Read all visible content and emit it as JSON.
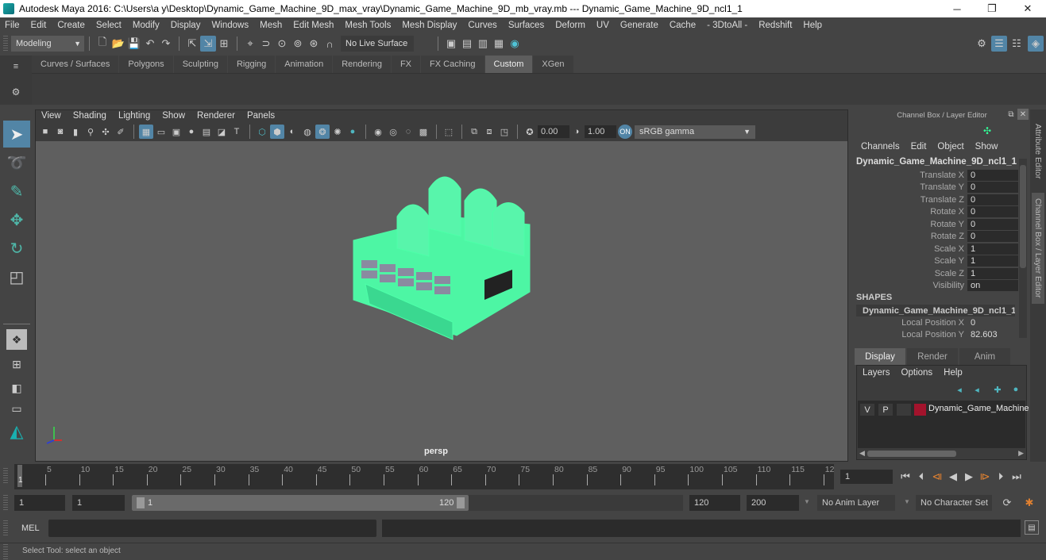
{
  "window": {
    "title": "Autodesk Maya 2016: C:\\Users\\a y\\Desktop\\Dynamic_Game_Machine_9D_max_vray\\Dynamic_Game_Machine_9D_mb_vray.mb  ---  Dynamic_Game_Machine_9D_ncl1_1",
    "minimize": "─",
    "maximize": "❐",
    "close": "✕"
  },
  "menubar": [
    "File",
    "Edit",
    "Create",
    "Select",
    "Modify",
    "Display",
    "Windows",
    "Mesh",
    "Edit Mesh",
    "Mesh Tools",
    "Mesh Display",
    "Curves",
    "Surfaces",
    "Deform",
    "UV",
    "Generate",
    "Cache",
    "- 3DtoAll -",
    "Redshift",
    "Help"
  ],
  "statusline": {
    "mode": "Modeling",
    "live_surface": "No Live Surface"
  },
  "shelf": {
    "tabs": [
      "Curves / Surfaces",
      "Polygons",
      "Sculpting",
      "Rigging",
      "Animation",
      "Rendering",
      "FX",
      "FX Caching",
      "Custom",
      "XGen"
    ],
    "active_tab": "Custom"
  },
  "panel": {
    "menu": [
      "View",
      "Shading",
      "Lighting",
      "Show",
      "Renderer",
      "Panels"
    ],
    "exposure": "0.00",
    "gamma": "1.00",
    "color_space": "sRGB gamma",
    "camera_label": "persp"
  },
  "channelbox": {
    "header": "Channel Box / Layer Editor",
    "menu": [
      "Channels",
      "Edit",
      "Object",
      "Show"
    ],
    "object_name": "Dynamic_Game_Machine_9D_ncl1_1",
    "channels": [
      {
        "name": "Translate X",
        "value": "0"
      },
      {
        "name": "Translate Y",
        "value": "0"
      },
      {
        "name": "Translate Z",
        "value": "0"
      },
      {
        "name": "Rotate X",
        "value": "0"
      },
      {
        "name": "Rotate Y",
        "value": "0"
      },
      {
        "name": "Rotate Z",
        "value": "0"
      },
      {
        "name": "Scale X",
        "value": "1"
      },
      {
        "name": "Scale Y",
        "value": "1"
      },
      {
        "name": "Scale Z",
        "value": "1"
      },
      {
        "name": "Visibility",
        "value": "on"
      }
    ],
    "shapes_label": "SHAPES",
    "shape_name": "Dynamic_Game_Machine_9D_ncl1_1...",
    "shape_channels": [
      {
        "name": "Local Position X",
        "value": "0"
      },
      {
        "name": "Local Position Y",
        "value": "82.603"
      }
    ]
  },
  "side_tabs": [
    "Attribute Editor",
    "Channel Box / Layer Editor"
  ],
  "layer_editor": {
    "tabs": [
      "Display",
      "Render",
      "Anim"
    ],
    "active_tab": "Display",
    "menu": [
      "Layers",
      "Options",
      "Help"
    ],
    "layers": [
      {
        "v": "V",
        "p": "P",
        "name": "Dynamic_Game_Machine",
        "color": "#a3132c"
      }
    ]
  },
  "timeline": {
    "ticks": [
      "5",
      "10",
      "15",
      "20",
      "25",
      "30",
      "35",
      "40",
      "45",
      "50",
      "55",
      "60",
      "65",
      "70",
      "75",
      "80",
      "85",
      "90",
      "95",
      "100",
      "105",
      "110",
      "115",
      "12"
    ],
    "current_frame_marker": "1",
    "current_frame": "1"
  },
  "range": {
    "start": "1",
    "anim_start": "1",
    "slider_start": "1",
    "slider_end": "120",
    "end": "120",
    "anim_end": "200",
    "anim_layer": "No Anim Layer",
    "character_set": "No Character Set"
  },
  "command": {
    "lang": "MEL"
  },
  "help_line": "Select Tool: select an object",
  "colors": {
    "accent": "#5285a6",
    "wireframe": "#4dffa8",
    "viewport_bg": "#5f5f5f"
  }
}
